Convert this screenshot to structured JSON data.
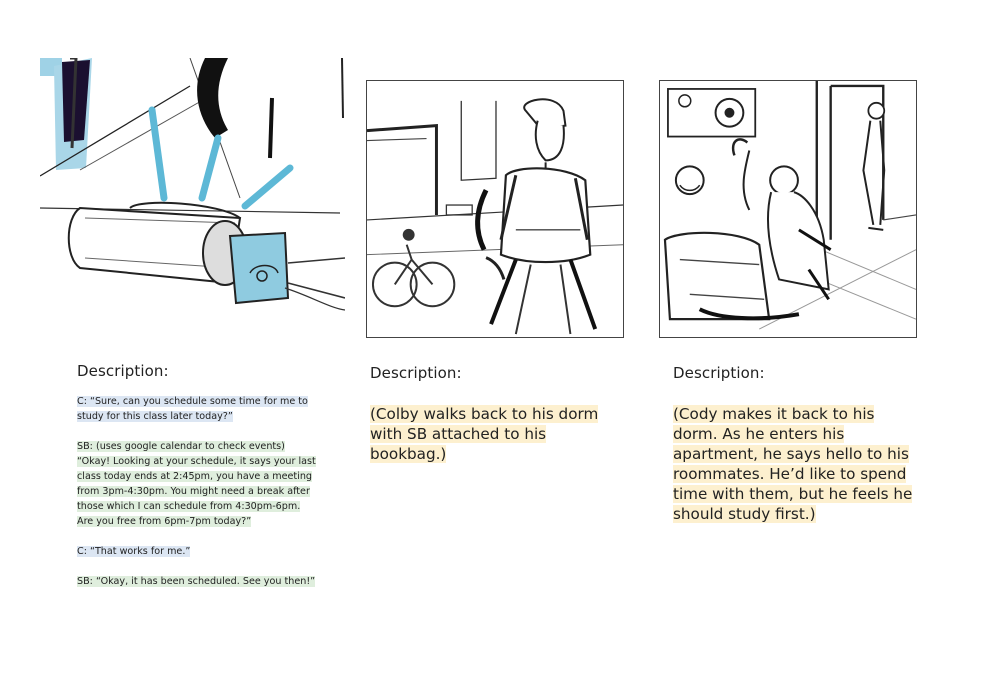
{
  "panels": [
    {
      "description_label": "Description:",
      "dialog": [
        {
          "speaker": "C",
          "text": "C: “Sure, can you schedule some time for me to study for this class later today?”"
        },
        {
          "speaker": "SB",
          "text": "SB: (uses google calendar to check events) “Okay! Looking at your schedule, it says your last class today ends at 2:45pm, you have a meeting from 3pm-4:30pm. You might need a break after those which I can schedule from 4:30pm-6pm. Are you free from 6pm-7pm today?”"
        },
        {
          "speaker": "C",
          "text": "C: “That works for me.”"
        },
        {
          "speaker": "SB",
          "text": "SB: “Okay, it has been scheduled. See you then!”"
        }
      ]
    },
    {
      "description_label": "Description:",
      "caption": "(Colby walks back to his dorm with SB attached to his bookbag.)"
    },
    {
      "description_label": "Description:",
      "caption": "(Cody makes it back to his dorm. As he enters his apartment, he says hello to his roommates. He’d like to spend time with them, but he feels he should study first.)"
    }
  ],
  "colors": {
    "highlight_user": "#dce6f3",
    "highlight_assistant": "#dfeedd",
    "highlight_caption": "#fdf0cf",
    "device_accent": "#8fcbe0"
  }
}
